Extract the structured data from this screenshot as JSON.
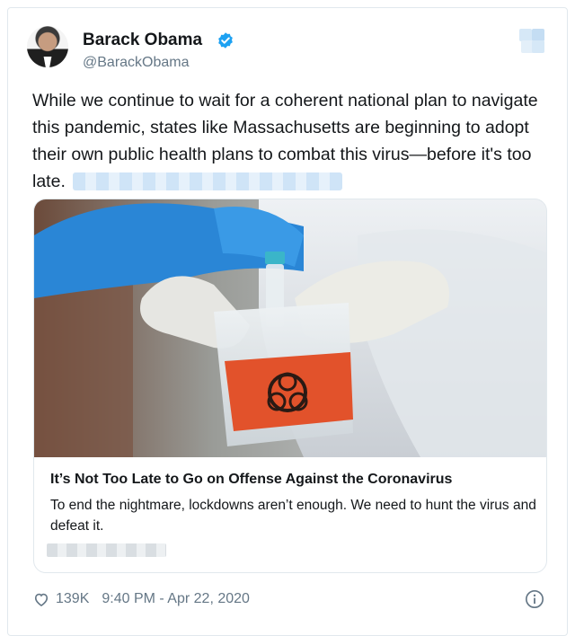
{
  "tweet": {
    "author_name": "Barack Obama",
    "author_handle": "@BarackObama",
    "text": "While we continue to wait for a coherent national plan to navigate this pandemic, states like Massachusetts are beginning to adopt their own public health plans to combat this virus—before it's too late.",
    "likes": "139K",
    "timestamp": "9:40 PM - Apr 22, 2020"
  },
  "link_card": {
    "title": "It’s Not Too Late to Go on Offense Against the Coronavirus",
    "description": "To end the nightmare, lockdowns aren’t enough. We need to hunt the virus and defeat it."
  },
  "icons": {
    "verified": "verified-badge-icon",
    "like": "heart-icon",
    "info": "info-icon",
    "brand": "twitter-logo-icon"
  },
  "colors": {
    "verified_blue": "#1da1f2",
    "secondary_text": "#657786",
    "biohazard_orange": "#e2522b"
  }
}
